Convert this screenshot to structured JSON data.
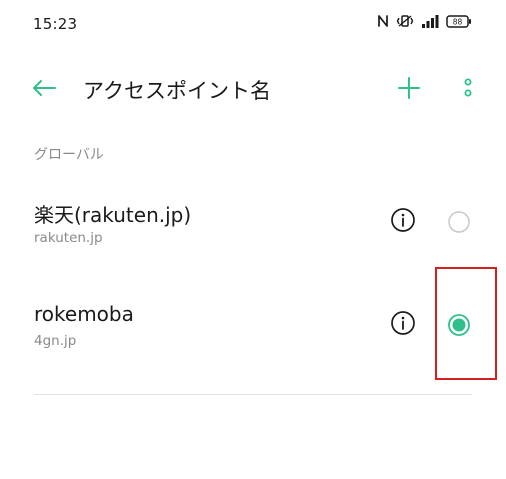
{
  "status_bar": {
    "time": "15:23",
    "icons": [
      "nfc-icon",
      "vibrate-icon",
      "signal-icon",
      "battery-icon"
    ],
    "battery_level": "88"
  },
  "app_bar": {
    "title": "アクセスポイント名",
    "back_icon": "arrow-left-icon",
    "add_icon": "plus-icon",
    "more_icon": "more-vertical-icon"
  },
  "section": {
    "header": "グローバル"
  },
  "apns": [
    {
      "name": "楽天(rakuten.jp)",
      "apn": "rakuten.jp",
      "selected": false
    },
    {
      "name": "rokemoba",
      "apn": "4gn.jp",
      "selected": true
    }
  ],
  "colors": {
    "accent": "#2fc089",
    "text_primary": "#1a1a1a",
    "text_secondary": "#8a8a8a",
    "highlight": "#d42020",
    "radio_off": "#c8c8c8"
  }
}
